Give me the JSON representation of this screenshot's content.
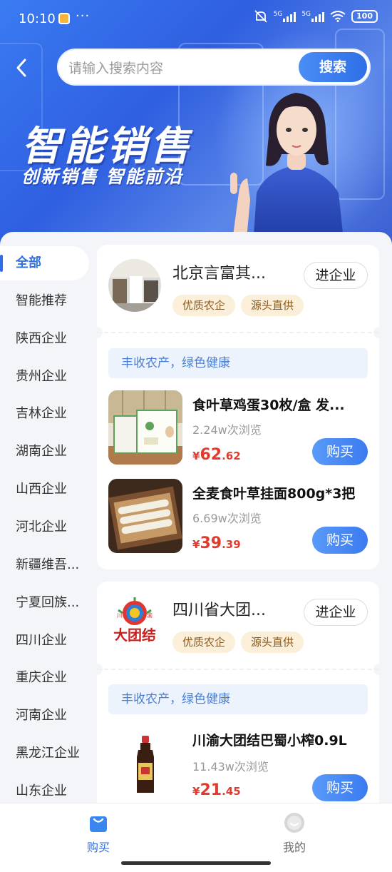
{
  "status_bar": {
    "time": "10:10",
    "signal1_label": "5G",
    "signal2_label": "5G",
    "battery": "100"
  },
  "search": {
    "placeholder": "请输入搜索内容",
    "button_label": "搜索"
  },
  "banner": {
    "title": "智能销售",
    "subtitle": "创新销售  智能前沿"
  },
  "sidebar": {
    "items": [
      {
        "label": "全部",
        "active": true
      },
      {
        "label": "智能推荐"
      },
      {
        "label": "陕西企业"
      },
      {
        "label": "贵州企业"
      },
      {
        "label": "吉林企业"
      },
      {
        "label": "湖南企业"
      },
      {
        "label": "山西企业"
      },
      {
        "label": "河北企业"
      },
      {
        "label": "新疆维吾..."
      },
      {
        "label": "宁夏回族..."
      },
      {
        "label": "四川企业"
      },
      {
        "label": "重庆企业"
      },
      {
        "label": "河南企业"
      },
      {
        "label": "黑龙江企业"
      },
      {
        "label": "山东企业"
      }
    ]
  },
  "enterprises": [
    {
      "name": "北京言富其...",
      "enter_label": "进企业",
      "tags": [
        "优质农企",
        "源头直供"
      ],
      "slogan": "丰收农产，绿色健康",
      "products": [
        {
          "name": "食叶草鸡蛋30枚/盒 发...",
          "views": "2.24w次浏览",
          "currency": "¥",
          "price_int": "62",
          "price_dec": ".62",
          "buy_label": "购买"
        },
        {
          "name": "全麦食叶草挂面800g*3把",
          "views": "6.69w次浏览",
          "currency": "¥",
          "price_int": "39",
          "price_dec": ".39",
          "buy_label": "购买"
        }
      ]
    },
    {
      "name": "四川省大团...",
      "enter_label": "进企业",
      "logo_text": "大团结",
      "logo_small_left": "川",
      "logo_small_right": "渝",
      "tags": [
        "优质农企",
        "源头直供"
      ],
      "slogan": "丰收农产，绿色健康",
      "products": [
        {
          "name": "川渝大团结巴蜀小榨0.9L",
          "views": "11.43w次浏览",
          "currency": "¥",
          "price_int": "21",
          "price_dec": ".45",
          "buy_label": "购买"
        }
      ]
    }
  ],
  "bottom_nav": {
    "items": [
      {
        "label": "购买",
        "active": true,
        "icon": "shopping-bag-icon"
      },
      {
        "label": "我的",
        "active": false,
        "icon": "profile-icon"
      }
    ]
  },
  "colors": {
    "accent": "#2f6fe6",
    "price": "#e23b2e",
    "tag_bg": "#fbefd9",
    "slogan_bg": "#edf3fd"
  }
}
